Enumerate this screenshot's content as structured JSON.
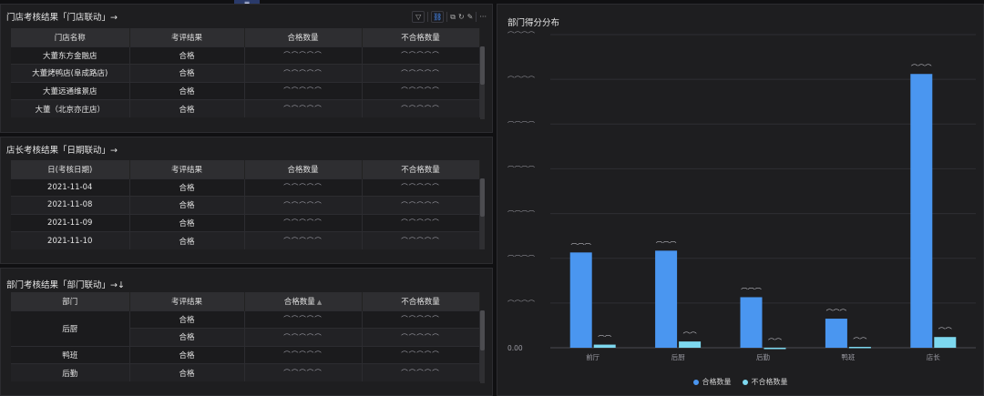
{
  "store_panel": {
    "title": "门店考核结果「门店联动」→",
    "columns": [
      "门店名称",
      "考评结果",
      "合格数量",
      "不合格数量"
    ],
    "rows": [
      [
        "大董东方金融店",
        "合格",
        "⌒⌒⌒⌒⌒",
        "⌒⌒⌒⌒⌒"
      ],
      [
        "大董烤鸭店(阜成路店)",
        "合格",
        "⌒⌒⌒⌒⌒",
        "⌒⌒⌒⌒⌒"
      ],
      [
        "大董远通维景店",
        "合格",
        "⌒⌒⌒⌒⌒",
        "⌒⌒⌒⌒⌒"
      ],
      [
        "大董（北京亦庄店）",
        "合格",
        "⌒⌒⌒⌒⌒",
        "⌒⌒⌒⌒⌒"
      ]
    ]
  },
  "manager_panel": {
    "title": "店长考核结果「日期联动」→",
    "columns": [
      "日(考核日期)",
      "考评结果",
      "合格数量",
      "不合格数量"
    ],
    "rows": [
      [
        "2021-11-04",
        "合格",
        "⌒⌒⌒⌒⌒",
        "⌒⌒⌒⌒⌒"
      ],
      [
        "2021-11-08",
        "合格",
        "⌒⌒⌒⌒⌒",
        "⌒⌒⌒⌒⌒"
      ],
      [
        "2021-11-09",
        "合格",
        "⌒⌒⌒⌒⌒",
        "⌒⌒⌒⌒⌒"
      ],
      [
        "2021-11-10",
        "合格",
        "⌒⌒⌒⌒⌒",
        "⌒⌒⌒⌒⌒"
      ]
    ]
  },
  "dept_panel": {
    "title": "部门考核结果「部门联动」→↓",
    "columns": [
      "部门",
      "考评结果",
      "合格数量",
      "不合格数量"
    ],
    "sort_icon": "▲",
    "rows": [
      [
        "后厨",
        "合格",
        "⌒⌒⌒⌒⌒",
        "⌒⌒⌒⌒⌒"
      ],
      [
        "",
        "合格",
        "⌒⌒⌒⌒⌒",
        "⌒⌒⌒⌒⌒"
      ],
      [
        "鸭班",
        "合格",
        "⌒⌒⌒⌒⌒",
        "⌒⌒⌒⌒⌒"
      ],
      [
        "后勤",
        "合格",
        "⌒⌒⌒⌒⌒",
        "⌒⌒⌒⌒⌒"
      ]
    ]
  },
  "toolbar": {
    "icons": [
      "filter-icon",
      "linkage-icon",
      "export-icon",
      "refresh-icon",
      "edit-icon",
      "more-icon"
    ],
    "glyphs": [
      "▽",
      "⛓",
      "⧉",
      "↻",
      "✎",
      "···"
    ]
  },
  "drag_handle": {
    "glyph": "≡"
  },
  "chart_panel": {
    "title": "部门得分分布"
  },
  "chart_data": {
    "type": "bar",
    "title": "部门得分分布",
    "categories": [
      "前厅",
      "后厨",
      "后勤",
      "鸭班",
      "店长"
    ],
    "ylim": [
      0,
      7
    ],
    "y_ticks": [
      "0.00",
      "⌒⌒⌒⌒",
      "⌒⌒⌒⌒",
      "⌒⌒⌒⌒",
      "⌒⌒⌒⌒",
      "⌒⌒⌒⌒",
      "⌒⌒⌒⌒",
      "⌒⌒⌒⌒"
    ],
    "grid": true,
    "legend_position": "bottom",
    "series": [
      {
        "name": "合格数量",
        "color": "#4a96f0",
        "values": [
          2.13,
          2.17,
          1.13,
          0.65,
          6.12
        ],
        "labels": [
          "⌒⌒⌒",
          "⌒⌒⌒",
          "⌒⌒⌒",
          "⌒⌒⌒",
          "⌒⌒⌒"
        ]
      },
      {
        "name": "不合格数量",
        "color": "#7dd8ef",
        "values": [
          0.07,
          0.14,
          0.0,
          0.02,
          0.24
        ],
        "labels": [
          "⌒⌒",
          "⌒⌒",
          "⌒⌒",
          "⌒⌒",
          "⌒⌒"
        ]
      }
    ]
  }
}
